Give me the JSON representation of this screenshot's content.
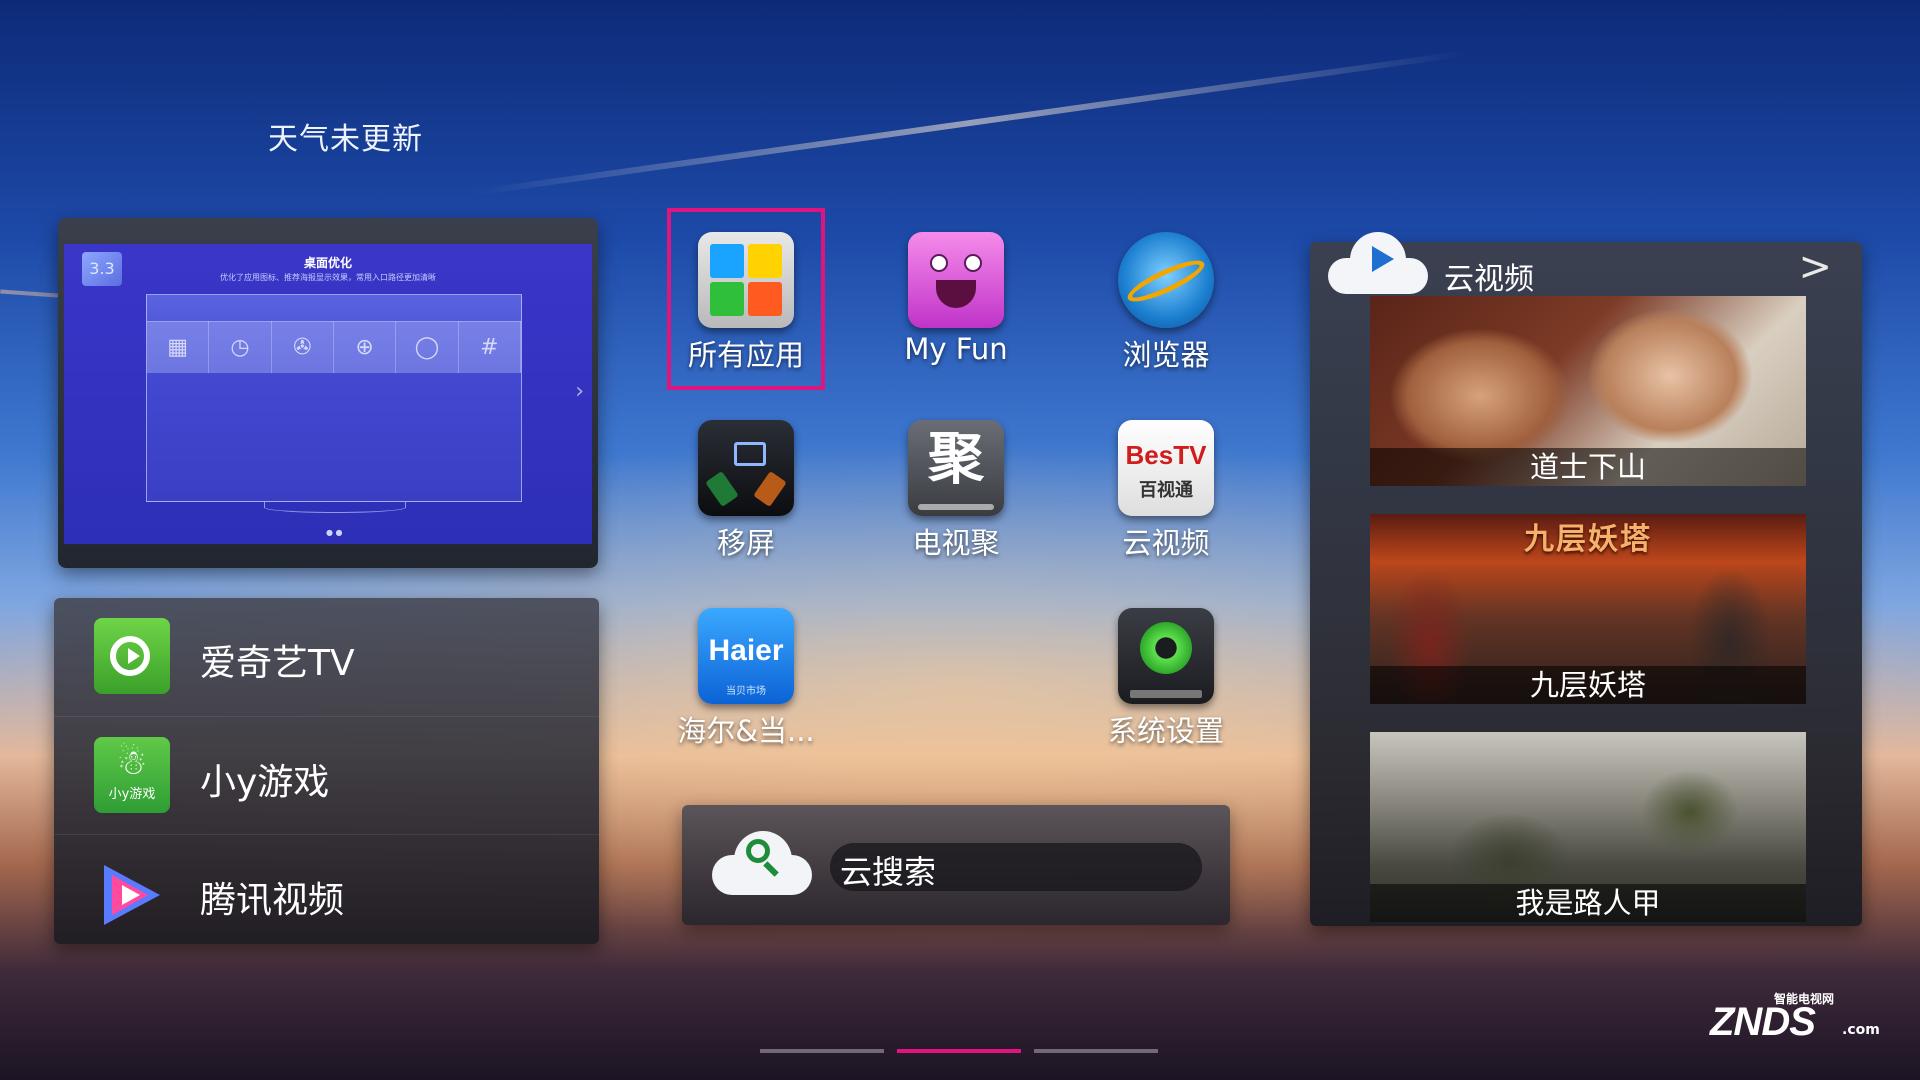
{
  "weather": {
    "text": "天气未更新"
  },
  "preview": {
    "badge": "3.3",
    "title": "桌面优化",
    "subtitle": "优化了应用图标、推荐海报显示效果，常用入口路径更加清晰"
  },
  "left_apps": [
    {
      "label": "爱奇艺TV",
      "icon": "iqiyi-icon"
    },
    {
      "label": "小y游戏",
      "icon": "xiaoy-game-icon",
      "icon_text": "小y游戏"
    },
    {
      "label": "腾讯视频",
      "icon": "tencent-video-icon"
    }
  ],
  "grid": [
    {
      "label": "所有应用",
      "icon": "all-apps-icon",
      "focused": true
    },
    {
      "label": "My Fun",
      "icon": "myfun-icon"
    },
    {
      "label": "浏览器",
      "icon": "browser-icon"
    },
    {
      "label": "移屏",
      "icon": "screen-cast-icon"
    },
    {
      "label": "电视聚",
      "icon": "tv-ju-icon",
      "icon_text": "聚"
    },
    {
      "label": "云视频",
      "icon": "bestv-icon",
      "icon_text1": "BesTV",
      "icon_text2": "百视通"
    },
    {
      "label": "海尔&当...",
      "icon": "haier-icon",
      "icon_text1": "Haier",
      "icon_text2": "当贝市场"
    },
    {
      "label": "系统设置",
      "icon": "settings-icon"
    }
  ],
  "search": {
    "label": "云搜索"
  },
  "cloud_video": {
    "title": "云视频",
    "more": ">",
    "posters": [
      {
        "title": "道士下山"
      },
      {
        "title": "九层妖塔",
        "poster_text": "九层妖塔"
      },
      {
        "title": "我是路人甲"
      }
    ]
  },
  "pager": {
    "pages": 3,
    "active": 1
  },
  "watermark": {
    "brand": "ZNDS",
    "suffix": ".com",
    "cn": "智能电视网"
  },
  "colors": {
    "focus": "#e0147e",
    "accent": "#1f6fd0"
  }
}
